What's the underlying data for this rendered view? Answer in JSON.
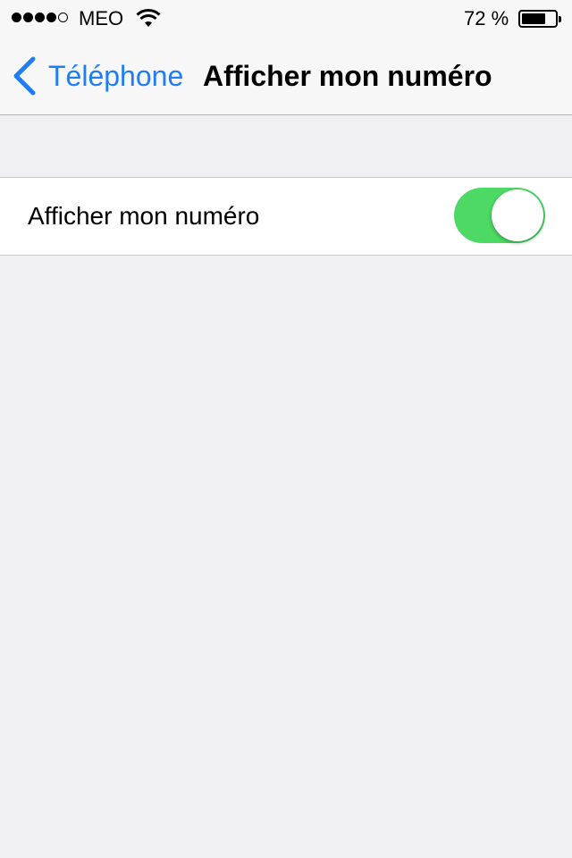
{
  "status_bar": {
    "signal_bars_filled": 4,
    "signal_bars_total": 5,
    "carrier": "MEO",
    "battery_text": "72 %",
    "battery_level": 0.72
  },
  "nav": {
    "back_label": "Téléphone",
    "title": "Afficher mon numéro"
  },
  "settings": {
    "rows": [
      {
        "label": "Afficher mon numéro",
        "toggle_on": true
      }
    ]
  },
  "colors": {
    "accent": "#1f7ef5",
    "toggle_on": "#4cd964",
    "background": "#efeff4"
  },
  "icons": [
    "signal-icon",
    "wifi-icon",
    "battery-icon",
    "back-chevron-icon"
  ]
}
